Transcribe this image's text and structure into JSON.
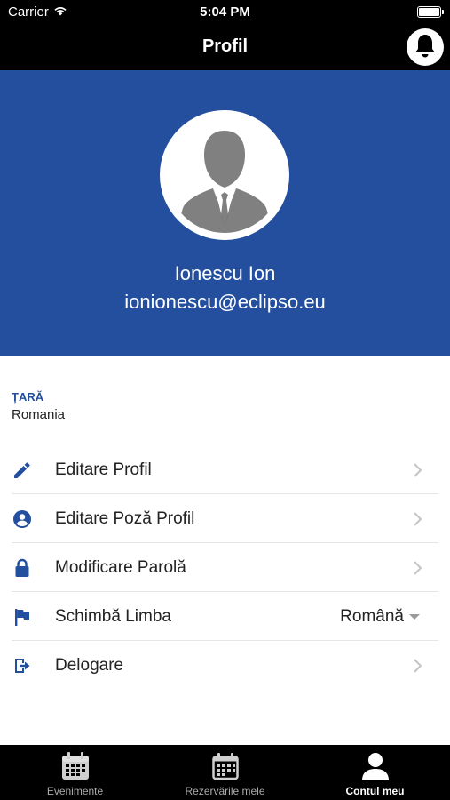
{
  "status_bar": {
    "carrier": "Carrier",
    "time": "5:04 PM"
  },
  "nav": {
    "title": "Profil"
  },
  "profile": {
    "name": "Ionescu Ion",
    "email": "ionionescu@eclipso.eu"
  },
  "country": {
    "label": "ȚARĂ",
    "value": "Romania"
  },
  "menu": {
    "items": [
      {
        "label": "Editare Profil",
        "icon": "pencil-icon"
      },
      {
        "label": "Editare Poză Profil",
        "icon": "user-circle-icon"
      },
      {
        "label": "Modificare Parolă",
        "icon": "lock-icon"
      },
      {
        "label": "Schimbă Limba",
        "icon": "flag-icon",
        "value": "Română"
      },
      {
        "label": "Delogare",
        "icon": "logout-icon"
      }
    ]
  },
  "tabs": [
    {
      "label": "Evenimente",
      "icon": "calendar-icon",
      "active": false
    },
    {
      "label": "Rezervările mele",
      "icon": "calendar-icon",
      "active": false
    },
    {
      "label": "Contul meu",
      "icon": "user-icon",
      "active": true
    }
  ],
  "colors": {
    "brand": "#244e9e",
    "bar": "#000000"
  }
}
